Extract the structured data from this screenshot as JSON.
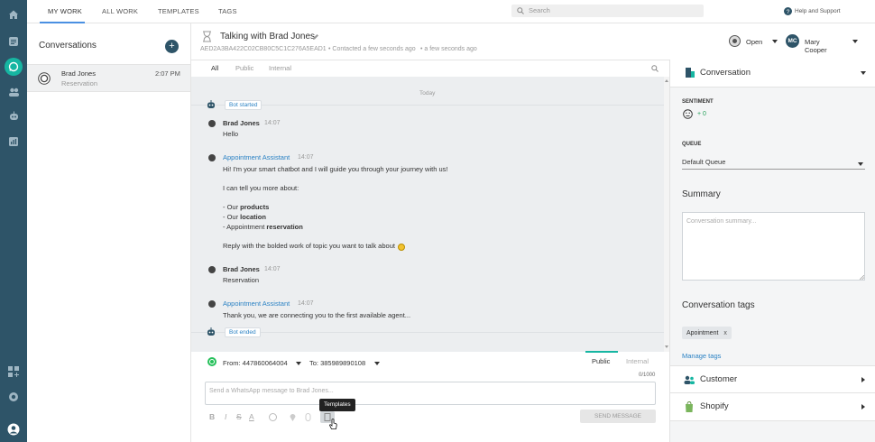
{
  "nav": {
    "icons": [
      "home-icon",
      "list-icon",
      "chat-icon",
      "people-icon",
      "robot-icon",
      "chart-icon",
      "apps-icon",
      "support-icon",
      "avatar-icon"
    ]
  },
  "topbar": {
    "tabs": [
      {
        "label": "MY WORK",
        "active": true
      },
      {
        "label": "ALL WORK"
      },
      {
        "label": "TEMPLATES"
      },
      {
        "label": "TAGS"
      }
    ],
    "search_placeholder": "Search",
    "help_label": "Help and Support"
  },
  "conversations": {
    "title": "Conversations",
    "add_label": "+",
    "items": [
      {
        "name": "Brad Jones",
        "subtitle": "Reservation",
        "time": "2:07 PM"
      }
    ]
  },
  "header": {
    "title": "Talking with Brad Jones",
    "conv_id": "AED2A3BA422C02CB80C5C1C276A5EAD1",
    "contacted": "• Contacted a few seconds ago",
    "updated": "• a few seconds ago",
    "status": "Open",
    "agent_initials": "MC",
    "agent_name": "Mary Cooper"
  },
  "chat_tabs": [
    {
      "label": "All",
      "active": true
    },
    {
      "label": "Public"
    },
    {
      "label": "Internal"
    }
  ],
  "chat": {
    "day_label": "Today",
    "bot_started": "Bot started",
    "bot_ended": "Bot ended",
    "m1": {
      "name": "Brad Jones",
      "time": "14:07",
      "text": "Hello"
    },
    "m2": {
      "name": "Appointment Assistant",
      "time": "14:07",
      "l1": "Hi! I'm your smart chatbot and I will guide you through your journey with us!",
      "l2": "I can tell you more about:",
      "l3a": "- Our ",
      "l3b": "products",
      "l4a": "- Our ",
      "l4b": "location",
      "l5a": "- Appointment ",
      "l5b": "reservation",
      "l6": "Reply with the bolded work of topic you want to talk about"
    },
    "m3": {
      "name": "Brad Jones",
      "time": "14:07",
      "text": "Reservation"
    },
    "m4": {
      "name": "Appointment Assistant",
      "time": "14:07",
      "text": "Thank you, we are connecting you to the first available agent..."
    }
  },
  "composer": {
    "from": "From: 447860064004",
    "to": "To: 385989890108",
    "mode_public": "Public",
    "mode_internal": "Internal",
    "counter": "0/1000",
    "placeholder": "Send a WhatsApp message to Brad Jones...",
    "tooltip": "Templates",
    "send_label": "SEND MESSAGE",
    "format_buttons": [
      "B",
      "I",
      "S",
      "A"
    ]
  },
  "details": {
    "conversation_title": "Conversation",
    "sentiment_label": "SENTIMENT",
    "sentiment_value": "+ 0",
    "queue_label": "QUEUE",
    "queue_value": "Default Queue",
    "summary_title": "Summary",
    "summary_placeholder": "Conversation summary...",
    "tags_title": "Conversation tags",
    "tag": "Apointment",
    "tag_remove": "x",
    "manage_tags": "Manage tags",
    "customer_title": "Customer",
    "shopify_title": "Shopify"
  },
  "colors": {
    "nav_bg": "#2e5468",
    "accent": "#16b6a2",
    "link": "#2b82c4",
    "send_bg": "#e6e6e6"
  }
}
